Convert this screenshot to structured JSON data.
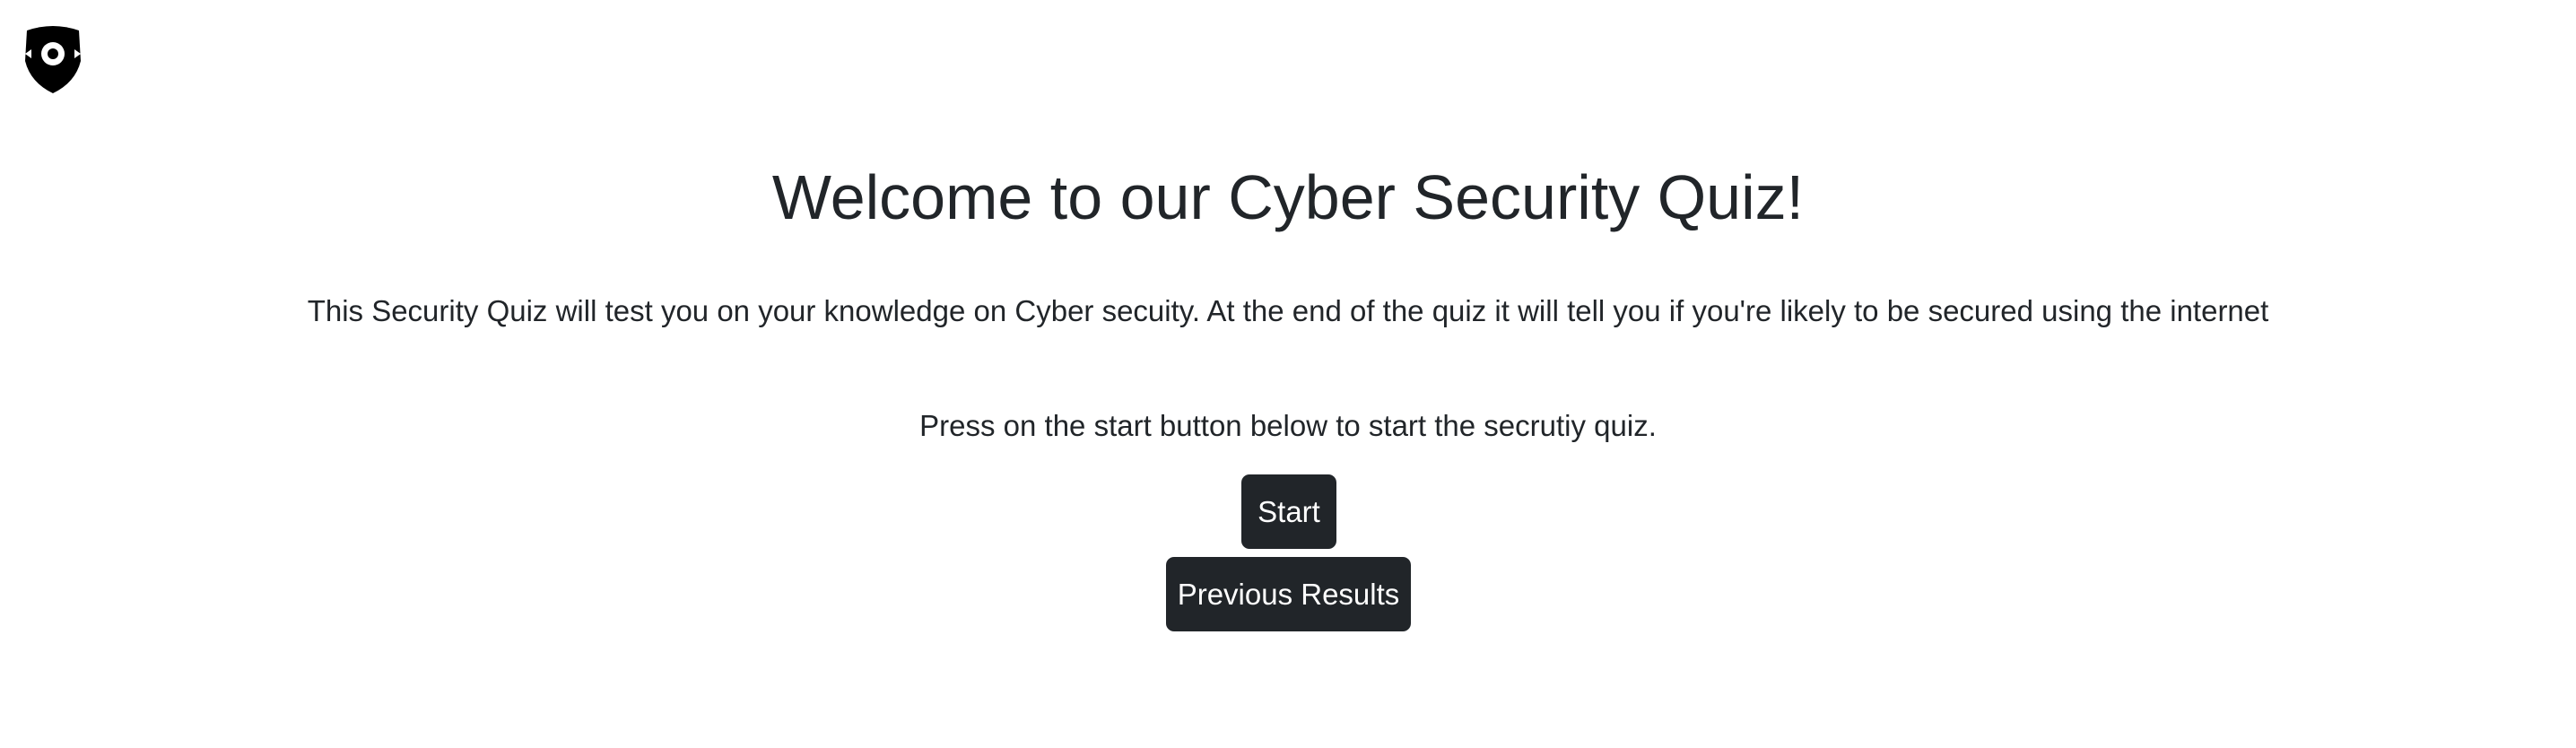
{
  "header": {
    "logo_icon": "shield-eye-icon"
  },
  "main": {
    "title": "Welcome to our Cyber Security Quiz!",
    "intro": "This Security Quiz will test you on your knowledge on Cyber secuity. At the end of the quiz it will tell you if you're likely to be secured using the internet",
    "instruction": "Press on the start button below to start the secrutiy quiz.",
    "start_button": "Start",
    "previous_results_button": "Previous Results"
  },
  "colors": {
    "button_bg": "#212529",
    "button_text": "#ffffff",
    "text": "#212529",
    "background": "#ffffff"
  }
}
